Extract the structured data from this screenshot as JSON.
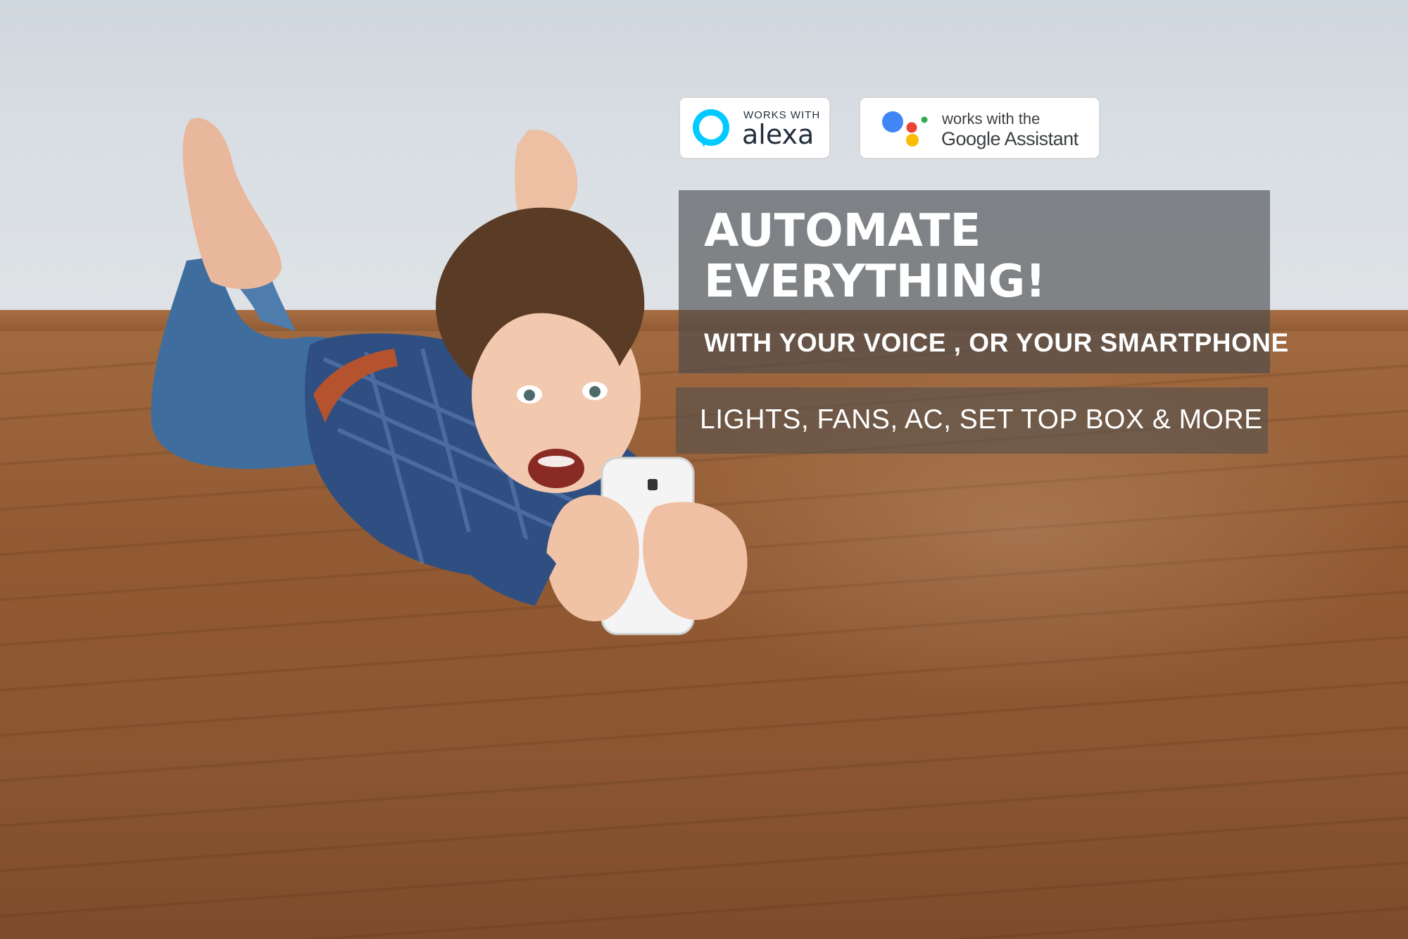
{
  "badges": {
    "alexa": {
      "small_text": "WORKS WITH",
      "big_text": "alexa",
      "ring_color": "#00caff",
      "icon": "alexa-logo-icon"
    },
    "google": {
      "line1": "works with the",
      "line2": "Google Assistant",
      "icon": "google-assistant-logo-icon",
      "dot_colors": [
        "#4285f4",
        "#ea4335",
        "#fbbc05",
        "#34a853"
      ]
    }
  },
  "hero": {
    "headline_line1": "AUTOMATE",
    "headline_line2": "EVERYTHING!",
    "subhead": "WITH YOUR VOICE , OR YOUR SMARTPHONE",
    "features": "LIGHTS, FANS, AC, SET TOP BOX & MORE"
  }
}
